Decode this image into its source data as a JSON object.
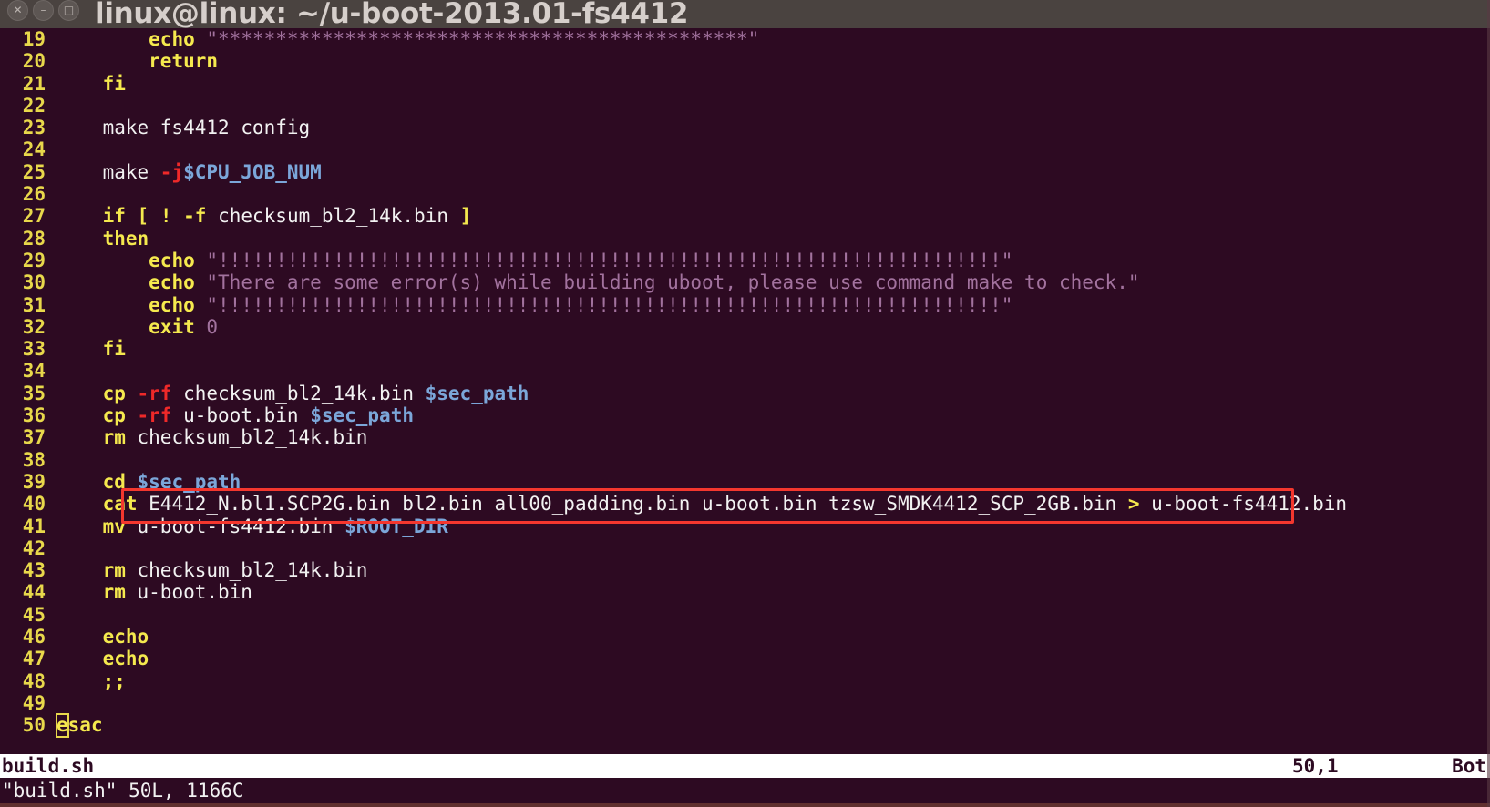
{
  "window": {
    "title": "linux@linux: ~/u-boot-2013.01-fs4412",
    "controls": [
      {
        "name": "close",
        "glyph": "✕"
      },
      {
        "name": "minimize",
        "glyph": "–"
      },
      {
        "name": "maximize",
        "glyph": "□"
      }
    ],
    "background_color": "#2d0a22",
    "titlebar_color": "#4a4340"
  },
  "editor": {
    "name": "vim",
    "colors": {
      "line_number": "#e8d84b",
      "keyword": "#f5e94e",
      "option_flag": "#ef2929",
      "variable": "#7ba6d9",
      "string": "#a2729e",
      "plain_text": "#f2f2f2",
      "cursor_outline": "#e8d84b",
      "annotation_box": "#f4372e"
    },
    "lines": [
      {
        "n": "19",
        "tokens": [
          {
            "t": "        ",
            "c": "plain"
          },
          {
            "t": "echo",
            "c": "kw"
          },
          {
            "t": " ",
            "c": "plain"
          },
          {
            "t": "\"**********************************************\"",
            "c": "str"
          }
        ]
      },
      {
        "n": "20",
        "tokens": [
          {
            "t": "        ",
            "c": "plain"
          },
          {
            "t": "return",
            "c": "kw"
          }
        ]
      },
      {
        "n": "21",
        "tokens": [
          {
            "t": "    ",
            "c": "plain"
          },
          {
            "t": "fi",
            "c": "kw"
          }
        ]
      },
      {
        "n": "22",
        "tokens": []
      },
      {
        "n": "23",
        "tokens": [
          {
            "t": "    make fs4412_config",
            "c": "plain"
          }
        ]
      },
      {
        "n": "24",
        "tokens": []
      },
      {
        "n": "25",
        "tokens": [
          {
            "t": "    make ",
            "c": "plain"
          },
          {
            "t": "-j",
            "c": "opt"
          },
          {
            "t": "$CPU_JOB_NUM",
            "c": "var"
          }
        ]
      },
      {
        "n": "26",
        "tokens": []
      },
      {
        "n": "27",
        "tokens": [
          {
            "t": "    ",
            "c": "plain"
          },
          {
            "t": "if",
            "c": "kw"
          },
          {
            "t": " ",
            "c": "plain"
          },
          {
            "t": "[",
            "c": "kw"
          },
          {
            "t": " ",
            "c": "plain"
          },
          {
            "t": "!",
            "c": "kw"
          },
          {
            "t": " ",
            "c": "plain"
          },
          {
            "t": "-f",
            "c": "kw"
          },
          {
            "t": " checksum_bl2_14k.bin ",
            "c": "plain"
          },
          {
            "t": "]",
            "c": "kw"
          }
        ]
      },
      {
        "n": "28",
        "tokens": [
          {
            "t": "    ",
            "c": "plain"
          },
          {
            "t": "then",
            "c": "kw"
          }
        ]
      },
      {
        "n": "29",
        "tokens": [
          {
            "t": "        ",
            "c": "plain"
          },
          {
            "t": "echo",
            "c": "kw"
          },
          {
            "t": " ",
            "c": "plain"
          },
          {
            "t": "\"!!!!!!!!!!!!!!!!!!!!!!!!!!!!!!!!!!!!!!!!!!!!!!!!!!!!!!!!!!!!!!!!!!!!\"",
            "c": "str"
          }
        ]
      },
      {
        "n": "30",
        "tokens": [
          {
            "t": "        ",
            "c": "plain"
          },
          {
            "t": "echo",
            "c": "kw"
          },
          {
            "t": " ",
            "c": "plain"
          },
          {
            "t": "\"There are some error(s) while building uboot, please use command make to check.\"",
            "c": "str"
          }
        ]
      },
      {
        "n": "31",
        "tokens": [
          {
            "t": "        ",
            "c": "plain"
          },
          {
            "t": "echo",
            "c": "kw"
          },
          {
            "t": " ",
            "c": "plain"
          },
          {
            "t": "\"!!!!!!!!!!!!!!!!!!!!!!!!!!!!!!!!!!!!!!!!!!!!!!!!!!!!!!!!!!!!!!!!!!!!\"",
            "c": "str"
          }
        ]
      },
      {
        "n": "32",
        "tokens": [
          {
            "t": "        ",
            "c": "plain"
          },
          {
            "t": "exit",
            "c": "kw"
          },
          {
            "t": " ",
            "c": "plain"
          },
          {
            "t": "0",
            "c": "num"
          }
        ]
      },
      {
        "n": "33",
        "tokens": [
          {
            "t": "    ",
            "c": "plain"
          },
          {
            "t": "fi",
            "c": "kw"
          }
        ]
      },
      {
        "n": "34",
        "tokens": []
      },
      {
        "n": "35",
        "tokens": [
          {
            "t": "    ",
            "c": "plain"
          },
          {
            "t": "cp",
            "c": "kw"
          },
          {
            "t": " ",
            "c": "plain"
          },
          {
            "t": "-rf",
            "c": "opt"
          },
          {
            "t": " checksum_bl2_14k.bin ",
            "c": "plain"
          },
          {
            "t": "$sec_path",
            "c": "var"
          }
        ]
      },
      {
        "n": "36",
        "tokens": [
          {
            "t": "    ",
            "c": "plain"
          },
          {
            "t": "cp",
            "c": "kw"
          },
          {
            "t": " ",
            "c": "plain"
          },
          {
            "t": "-rf",
            "c": "opt"
          },
          {
            "t": " u-boot.bin ",
            "c": "plain"
          },
          {
            "t": "$sec_path",
            "c": "var"
          }
        ]
      },
      {
        "n": "37",
        "tokens": [
          {
            "t": "    ",
            "c": "plain"
          },
          {
            "t": "rm",
            "c": "kw"
          },
          {
            "t": " checksum_bl2_14k.bin",
            "c": "plain"
          }
        ]
      },
      {
        "n": "38",
        "tokens": []
      },
      {
        "n": "39",
        "tokens": [
          {
            "t": "    ",
            "c": "plain"
          },
          {
            "t": "cd",
            "c": "kw"
          },
          {
            "t": " ",
            "c": "plain"
          },
          {
            "t": "$sec_path",
            "c": "var"
          }
        ]
      },
      {
        "n": "40",
        "tokens": [
          {
            "t": "    ",
            "c": "plain"
          },
          {
            "t": "cat",
            "c": "kw"
          },
          {
            "t": " E4412_N.bl1.SCP2G.bin bl2.bin all00_padding.bin u-boot.bin tzsw_SMDK4412_SCP_2GB.bin ",
            "c": "plain"
          },
          {
            "t": ">",
            "c": "kw"
          },
          {
            "t": " u-boot-fs4412.bin",
            "c": "plain"
          }
        ],
        "highlighted": true
      },
      {
        "n": "41",
        "tokens": [
          {
            "t": "    ",
            "c": "plain"
          },
          {
            "t": "mv",
            "c": "kw"
          },
          {
            "t": " u-boot-fs4412.bin ",
            "c": "plain"
          },
          {
            "t": "$ROOT_DIR",
            "c": "var"
          }
        ]
      },
      {
        "n": "42",
        "tokens": []
      },
      {
        "n": "43",
        "tokens": [
          {
            "t": "    ",
            "c": "plain"
          },
          {
            "t": "rm",
            "c": "kw"
          },
          {
            "t": " checksum_bl2_14k.bin",
            "c": "plain"
          }
        ]
      },
      {
        "n": "44",
        "tokens": [
          {
            "t": "    ",
            "c": "plain"
          },
          {
            "t": "rm",
            "c": "kw"
          },
          {
            "t": " u-boot.bin",
            "c": "plain"
          }
        ]
      },
      {
        "n": "45",
        "tokens": []
      },
      {
        "n": "46",
        "tokens": [
          {
            "t": "    ",
            "c": "plain"
          },
          {
            "t": "echo",
            "c": "kw"
          }
        ]
      },
      {
        "n": "47",
        "tokens": [
          {
            "t": "    ",
            "c": "plain"
          },
          {
            "t": "echo",
            "c": "kw"
          }
        ]
      },
      {
        "n": "48",
        "tokens": [
          {
            "t": "    ",
            "c": "plain"
          },
          {
            "t": ";;",
            "c": "kw"
          }
        ]
      },
      {
        "n": "49",
        "tokens": []
      },
      {
        "n": "50",
        "tokens": [
          {
            "t": "e",
            "c": "kw",
            "cursor": true
          },
          {
            "t": "sac",
            "c": "kw"
          }
        ]
      }
    ]
  },
  "status_line": {
    "filename": "build.sh",
    "position": "50,1",
    "scroll_state": "Bot"
  },
  "command_line": {
    "message": "\"build.sh\" 50L, 1166C"
  }
}
